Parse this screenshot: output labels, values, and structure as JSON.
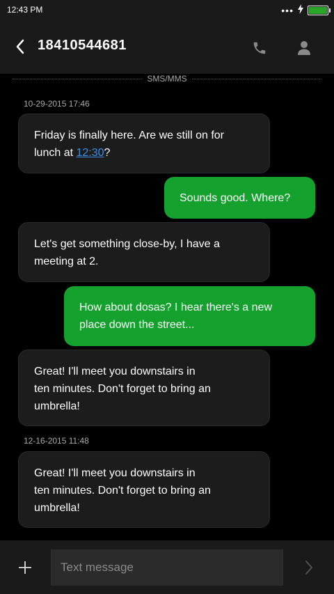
{
  "status_bar": {
    "time": "12:43 PM",
    "battery_level": 1.0,
    "battery_color": "#2aa52a",
    "icons": [
      "more-dots-icon",
      "charging-bolt-icon",
      "battery-icon"
    ]
  },
  "header": {
    "title": "18410544681",
    "back_icon": "chevron-left-icon",
    "call_icon": "phone-icon",
    "contact_icon": "person-icon"
  },
  "divider": {
    "label": "SMS/MMS"
  },
  "conversation": {
    "timestamps": [
      "10-29-2015 17:46",
      "12-16-2015 11:48"
    ],
    "messages": [
      {
        "dir": "in",
        "lines": [
          "Friday is finally here. Are we still on for"
        ],
        "line2_prefix": "lunch at ",
        "link": "12:30",
        "line2_suffix": "?"
      },
      {
        "dir": "out",
        "lines": [
          "Sounds good. Where?"
        ]
      },
      {
        "dir": "in",
        "lines": [
          "Let's get something close-by, I have a",
          "meeting at 2."
        ]
      },
      {
        "dir": "out",
        "lines": [
          "How about dosas? I hear there's a new",
          "place down the street..."
        ]
      },
      {
        "dir": "in",
        "lines": [
          "Great! I'll meet you downstairs in",
          "ten minutes. Don't forget to bring an",
          "umbrella!"
        ]
      },
      {
        "dir": "in",
        "lines": [
          "Great! I'll meet you downstairs in",
          "ten minutes. Don't forget to bring an",
          "umbrella!"
        ]
      }
    ]
  },
  "colors": {
    "outgoing_bubble": "#14a12e",
    "incoming_bubble": "#1c1c1c",
    "link": "#3a8ee8"
  },
  "composer": {
    "placeholder": "Text message",
    "value": "",
    "attach_icon": "plus-icon",
    "send_icon": "chevron-right-icon"
  }
}
